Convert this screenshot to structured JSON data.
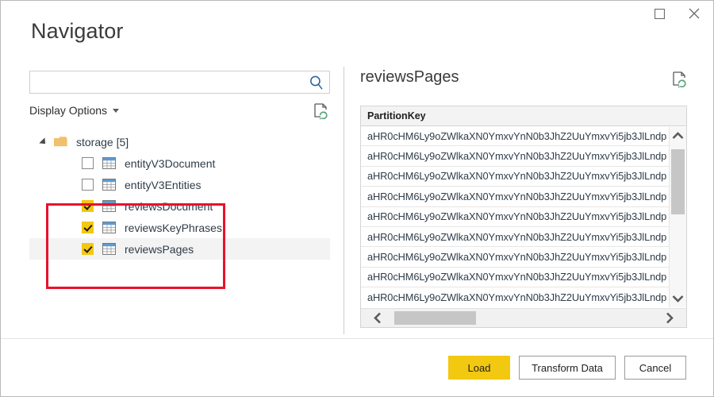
{
  "window": {
    "title": "Navigator",
    "controls": [
      {
        "name": "maximize-button",
        "icon": "maximize-icon",
        "label": "Maximize"
      },
      {
        "name": "close-button",
        "icon": "close-icon",
        "label": "Close"
      }
    ]
  },
  "search": {
    "value": "",
    "placeholder": "",
    "icon": "search-icon"
  },
  "display_options": {
    "label": "Display Options",
    "caret": "chevron-down-icon",
    "refresh_icon": "refresh-document-icon"
  },
  "tree": {
    "root": {
      "label": "storage [5]",
      "icon": "folder-icon",
      "expander": "expanded-triangle-icon",
      "expanded": true
    },
    "items": [
      {
        "label": "entityV3Document",
        "checked": false,
        "selected": false,
        "icon": "table-icon"
      },
      {
        "label": "entityV3Entities",
        "checked": false,
        "selected": false,
        "icon": "table-icon"
      },
      {
        "label": "reviewsDocument",
        "checked": true,
        "selected": false,
        "icon": "table-icon"
      },
      {
        "label": "reviewsKeyPhrases",
        "checked": true,
        "selected": false,
        "icon": "table-icon"
      },
      {
        "label": "reviewsPages",
        "checked": true,
        "selected": true,
        "icon": "table-icon"
      }
    ]
  },
  "preview": {
    "title": "reviewsPages",
    "refresh_icon": "refresh-document-icon",
    "columns": [
      "PartitionKey"
    ],
    "rows": [
      [
        "aHR0cHM6Ly9oZWlkaXN0YmxvYnN0b3JhZ2UuYmxvYi5jb3JlLndp"
      ],
      [
        "aHR0cHM6Ly9oZWlkaXN0YmxvYnN0b3JhZ2UuYmxvYi5jb3JlLndp"
      ],
      [
        "aHR0cHM6Ly9oZWlkaXN0YmxvYnN0b3JhZ2UuYmxvYi5jb3JlLndp"
      ],
      [
        "aHR0cHM6Ly9oZWlkaXN0YmxvYnN0b3JhZ2UuYmxvYi5jb3JlLndp"
      ],
      [
        "aHR0cHM6Ly9oZWlkaXN0YmxvYnN0b3JhZ2UuYmxvYi5jb3JlLndp"
      ],
      [
        "aHR0cHM6Ly9oZWlkaXN0YmxvYnN0b3JhZ2UuYmxvYi5jb3JlLndp"
      ],
      [
        "aHR0cHM6Ly9oZWlkaXN0YmxvYnN0b3JhZ2UuYmxvYi5jb3JlLndp"
      ],
      [
        "aHR0cHM6Ly9oZWlkaXN0YmxvYnN0b3JhZ2UuYmxvYi5jb3JlLndp"
      ],
      [
        "aHR0cHM6Ly9oZWlkaXN0YmxvYnN0b3JhZ2UuYmxvYi5jb3JlLndp"
      ]
    ],
    "vscroll": {
      "up_icon": "chevron-up-icon",
      "down_icon": "chevron-down-icon"
    },
    "hscroll": {
      "left_icon": "chevron-left-icon",
      "right_icon": "chevron-right-icon"
    }
  },
  "footer": {
    "load_label": "Load",
    "transform_label": "Transform Data",
    "cancel_label": "Cancel"
  },
  "annotation": {
    "shape": "rectangle",
    "color": "#e8112d"
  },
  "colors": {
    "accent_yellow": "#f2c811",
    "annotation_red": "#e8112d",
    "search_icon_blue": "#2a6099",
    "folder_gold": "#f0c06a",
    "refresh_green": "#5aa17a",
    "table_header_blue": "#5b9bd5"
  }
}
